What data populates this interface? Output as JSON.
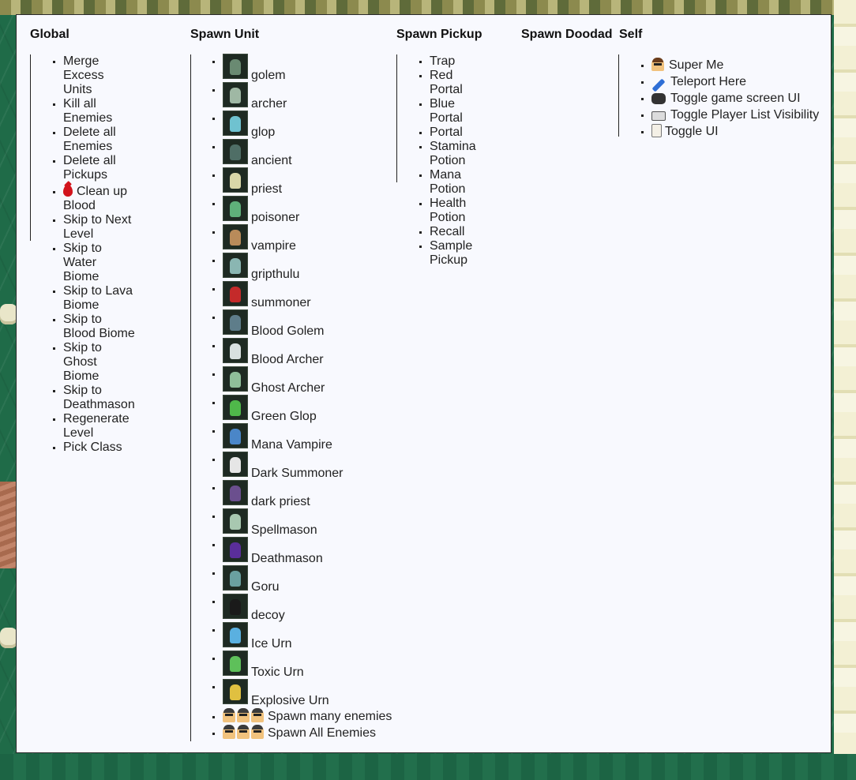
{
  "columns": {
    "global": {
      "title": "Global",
      "items": [
        {
          "label": "Merge Excess Units"
        },
        {
          "label": "Kill all Enemies"
        },
        {
          "label": "Delete all Enemies"
        },
        {
          "label": "Delete all Pickups"
        },
        {
          "label": "Clean up Blood",
          "icon": "blood-drop-icon"
        },
        {
          "label": "Skip to Next Level"
        },
        {
          "label": "Skip to Water Biome"
        },
        {
          "label": "Skip to Lava Biome"
        },
        {
          "label": "Skip to Blood Biome"
        },
        {
          "label": "Skip to Ghost Biome"
        },
        {
          "label": "Skip to Deathmason"
        },
        {
          "label": "Regenerate Level"
        },
        {
          "label": "Pick Class"
        }
      ]
    },
    "spawn_unit": {
      "title": "Spawn Unit",
      "units": [
        {
          "label": "golem",
          "color": "#6a8a72"
        },
        {
          "label": "archer",
          "color": "#9fb8a4"
        },
        {
          "label": "glop",
          "color": "#6fc2d0"
        },
        {
          "label": "ancient",
          "color": "#4f6e66"
        },
        {
          "label": "priest",
          "color": "#d9d7a8"
        },
        {
          "label": "poisoner",
          "color": "#5fb07a"
        },
        {
          "label": "vampire",
          "color": "#b98b5a"
        },
        {
          "label": "gripthulu",
          "color": "#8ab6b2"
        },
        {
          "label": "summoner",
          "color": "#c42a2a"
        },
        {
          "label": "Blood Golem",
          "color": "#5e7d8a"
        },
        {
          "label": "Blood Archer",
          "color": "#d8e0e0"
        },
        {
          "label": "Ghost Archer",
          "color": "#8fbf9a"
        },
        {
          "label": "Green Glop",
          "color": "#4fb84a"
        },
        {
          "label": "Mana Vampire",
          "color": "#4a86c8"
        },
        {
          "label": "Dark Summoner",
          "color": "#e6e6e6"
        },
        {
          "label": "dark priest",
          "color": "#6b4f8e"
        },
        {
          "label": "Spellmason",
          "color": "#a8c8b0"
        },
        {
          "label": "Deathmason",
          "color": "#5a2e9a"
        },
        {
          "label": "Goru",
          "color": "#6aa0a0"
        },
        {
          "label": "decoy",
          "color": "#1a1a1a"
        },
        {
          "label": "Ice Urn",
          "color": "#5ab0e0"
        },
        {
          "label": "Toxic Urn",
          "color": "#5ec05a"
        },
        {
          "label": "Explosive Urn",
          "color": "#e0c040"
        }
      ],
      "multi": [
        {
          "label": "Spawn many enemies",
          "icons": [
            "person-icon",
            "person-icon",
            "person-icon"
          ]
        },
        {
          "label": "Spawn All Enemies",
          "icons": [
            "person-icon",
            "vampire-icon",
            "person-icon"
          ]
        }
      ]
    },
    "spawn_pickup": {
      "title": "Spawn Pickup",
      "items": [
        {
          "label": "Trap"
        },
        {
          "label": "Red Portal"
        },
        {
          "label": "Blue Portal"
        },
        {
          "label": "Portal"
        },
        {
          "label": "Stamina Potion"
        },
        {
          "label": "Mana Potion"
        },
        {
          "label": "Health Potion"
        },
        {
          "label": "Recall"
        },
        {
          "label": "Sample Pickup"
        }
      ]
    },
    "spawn_doodad": {
      "title": "Spawn Doodad"
    },
    "self": {
      "title": "Self",
      "items": [
        {
          "label": "Super Me",
          "icon": "person-icon"
        },
        {
          "label": "Teleport Here",
          "icon": "syringe-icon"
        },
        {
          "label": "Toggle game screen UI",
          "icon": "gamepad-icon"
        },
        {
          "label": "Toggle Player List Visibility",
          "icon": "pager-icon"
        },
        {
          "label": "Toggle UI",
          "icon": "card-icon"
        }
      ]
    }
  }
}
